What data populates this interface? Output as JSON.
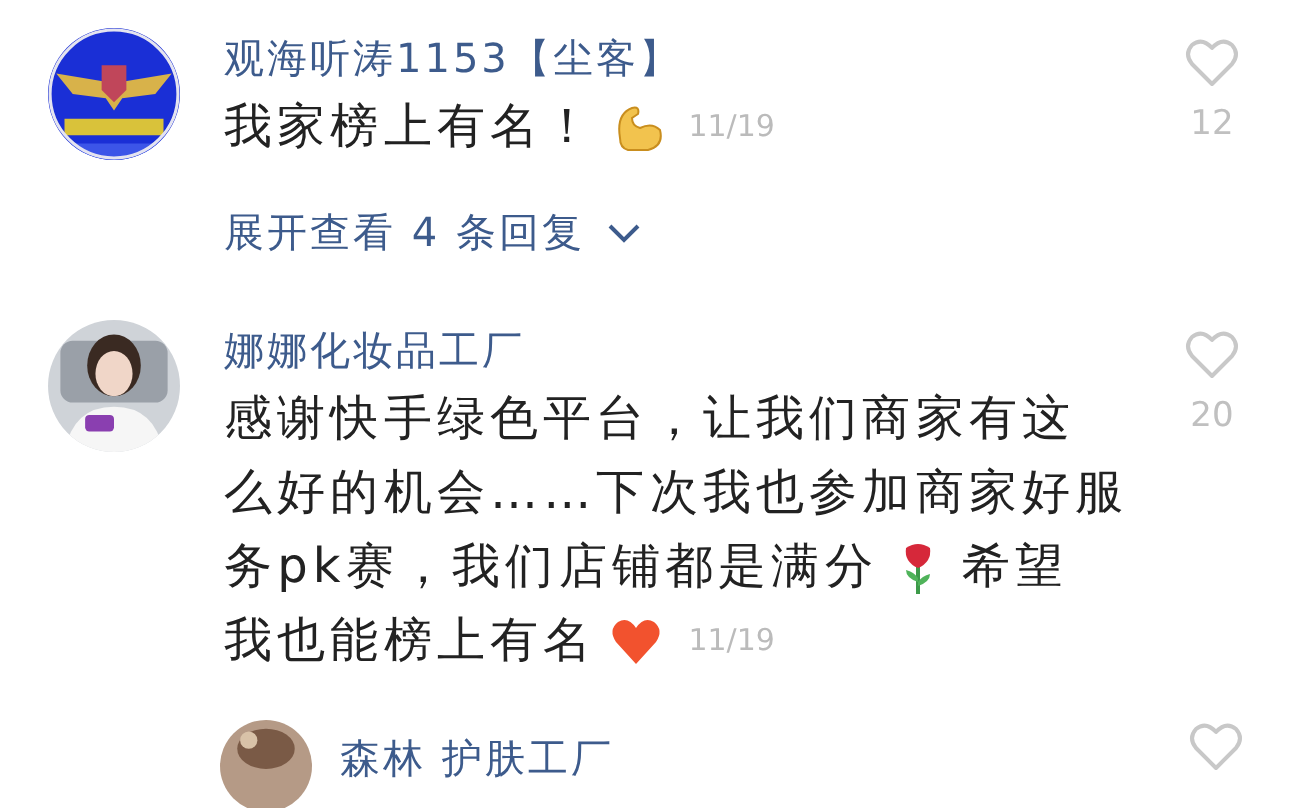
{
  "comments": [
    {
      "avatar": {
        "kind": "picture"
      },
      "name": "观海听涛1153【尘客】",
      "lines": [
        {
          "parts": [
            "我家榜上有名！"
          ]
        }
      ],
      "date": "11/19",
      "likes": "12",
      "replies_link": "展开查看 4 条回复"
    },
    {
      "avatar": {
        "kind": "picture"
      },
      "name": "娜娜化妆品工厂",
      "lines": [
        {
          "parts": [
            "感谢快手绿色平台，让我们商家有这"
          ]
        },
        {
          "parts": [
            "么好的机会……下次我也参加商家好服"
          ]
        },
        {
          "parts": [
            "务pk赛，我们店铺都是满分",
            "希望"
          ]
        },
        {
          "parts": [
            "我也能榜上有名"
          ]
        }
      ],
      "date": "11/19",
      "likes": "20"
    }
  ],
  "reply": {
    "avatar": {
      "kind": "picture"
    },
    "name": "森林 护肤工厂"
  }
}
